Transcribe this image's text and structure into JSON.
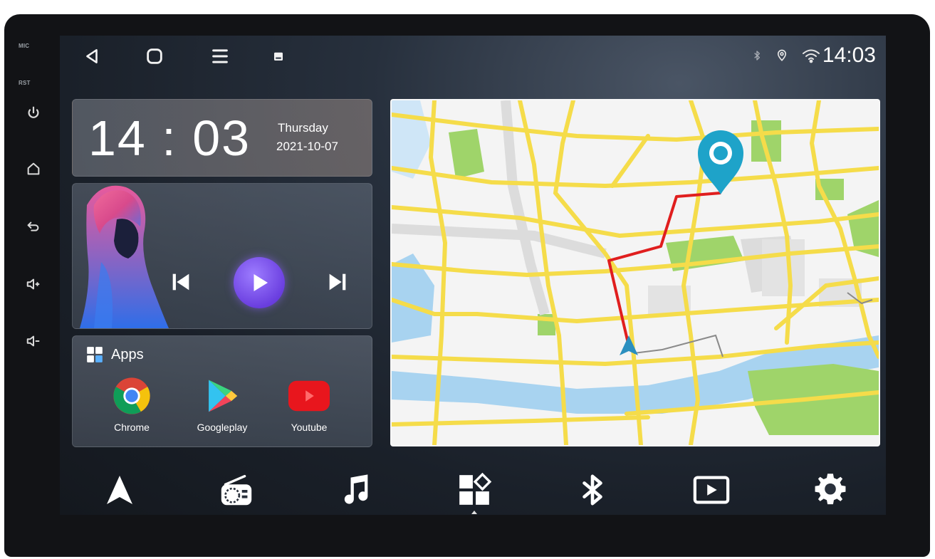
{
  "hardware": {
    "mic_label": "MIC",
    "rst_label": "RST",
    "buttons": [
      {
        "icon": "power-icon"
      },
      {
        "icon": "home-icon"
      },
      {
        "icon": "back-icon"
      },
      {
        "icon": "volume-up-icon"
      },
      {
        "icon": "volume-down-icon"
      }
    ]
  },
  "status_bar": {
    "nav": [
      "back-icon",
      "home-icon",
      "menu-icon",
      "recent-apps-icon"
    ],
    "indicators": [
      "bluetooth-icon",
      "location-icon",
      "wifi-icon"
    ],
    "time": "14:03"
  },
  "clock_widget": {
    "time": "14 : 03",
    "day": "Thursday",
    "date": "2021-10-07"
  },
  "music_widget": {
    "controls": [
      "previous-icon",
      "play-icon",
      "next-icon"
    ],
    "accent_color": "#7b4cf0"
  },
  "apps_widget": {
    "title": "Apps",
    "apps": [
      {
        "label": "Chrome",
        "icon": "chrome-icon"
      },
      {
        "label": "Googleplay",
        "icon": "google-play-icon"
      },
      {
        "label": "Youtube",
        "icon": "youtube-icon"
      }
    ]
  },
  "map_widget": {
    "route_color": "#e01e1e",
    "pin_color": "#1ea3c9",
    "road_color": "#f5dc4a",
    "park_color": "#9fd46a",
    "water_color": "#a8d3f0"
  },
  "dock": {
    "items": [
      {
        "name": "navigation",
        "icon": "navigation-arrow-icon"
      },
      {
        "name": "radio",
        "icon": "radio-icon"
      },
      {
        "name": "music",
        "icon": "music-note-icon"
      },
      {
        "name": "apps",
        "icon": "apps-grid-icon",
        "active": true
      },
      {
        "name": "bluetooth",
        "icon": "bluetooth-icon"
      },
      {
        "name": "video",
        "icon": "video-player-icon"
      },
      {
        "name": "settings",
        "icon": "settings-gear-icon"
      }
    ]
  }
}
